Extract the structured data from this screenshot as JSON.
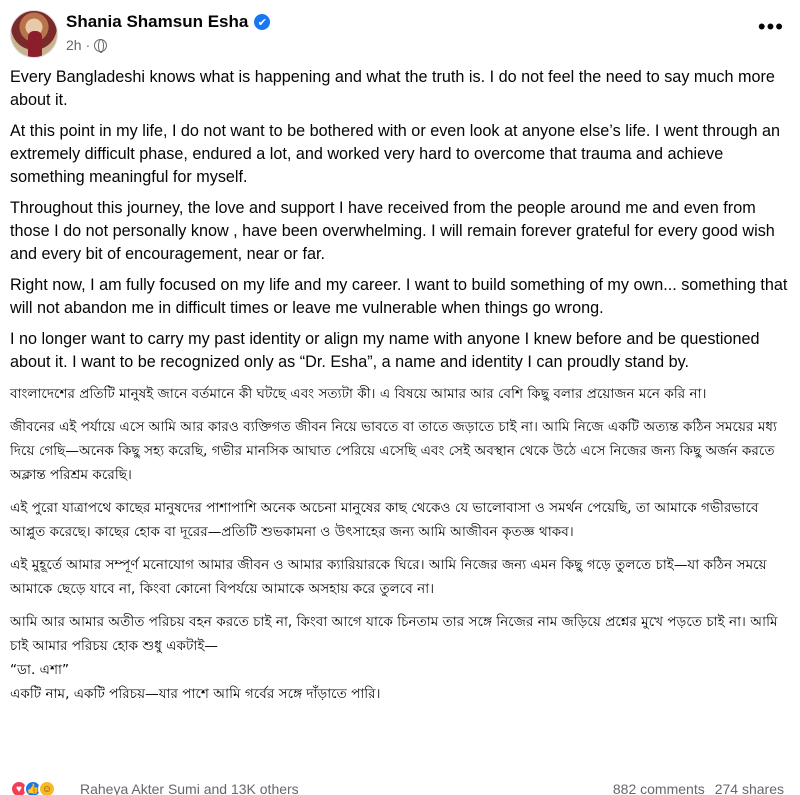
{
  "post": {
    "author": "Shania Shamsun Esha",
    "time": "2h",
    "separator": "·",
    "more_label": "•••",
    "verified_glyph": "✔",
    "paragraphs_en": [
      "Every Bangladeshi knows what is happening and what the truth is. I do not feel the need to say much more about it.",
      "At this point in my life, I do not want to be bothered with or even look at anyone else’s life. I went through an extremely difficult phase, endured a lot, and worked very hard to overcome that trauma and achieve something meaningful for myself.",
      "Throughout this journey, the love and support I have received from the people around me and even from those I do not personally know , have been overwhelming. I will remain forever grateful for every good wish and every bit of encouragement, near or far.",
      "Right now, I am fully focused on my life and my career. I want to build something of my own... something that will not abandon me in difficult times or leave me vulnerable when things go wrong.",
      "I no longer want to carry my past identity or align my name with anyone I knew before  and be questioned about it. I want to be recognized only as “Dr. Esha”, a name and identity I can proudly stand by."
    ],
    "paragraphs_bn": [
      "বাংলাদেশের প্রতিটি মানুষই জানে বর্তমানে কী ঘটছে এবং সত্যটা কী। এ বিষয়ে আমার আর বেশি কিছু বলার প্রয়োজন মনে করি না।",
      "জীবনের এই পর্যায়ে এসে আমি আর কারও ব্যক্তিগত জীবন নিয়ে ভাবতে বা তাতে জড়াতে চাই না। আমি নিজে একটি অত্যন্ত কঠিন সময়ের মধ্য দিয়ে গেছি—অনেক কিছু সহ্য করেছি, গভীর মানসিক আঘাত পেরিয়ে এসেছি এবং সেই অবস্থান থেকে উঠে এসে নিজের জন্য কিছু অর্জন করতে অক্লান্ত পরিশ্রম করেছি।",
      "এই পুরো যাত্রাপথে কাছের মানুষদের পাশাপাশি অনেক অচেনা মানুষের কাছ থেকেও যে ভালোবাসা ও সমর্থন পেয়েছি, তা আমাকে গভীরভাবে আপ্লুত করেছে। কাছের হোক বা দূরের—প্রতিটি শুভকামনা ও উৎসাহের জন্য আমি আজীবন কৃতজ্ঞ থাকব।",
      "এই মুহূর্তে আমার সম্পূর্ণ মনোযোগ আমার জীবন ও আমার ক্যারিয়ারকে ঘিরে। আমি নিজের জন্য এমন কিছু গড়ে তুলতে চাই—যা কঠিন সময়ে আমাকে ছেড়ে যাবে না, কিংবা কোনো বিপর্যয়ে আমাকে অসহায় করে তুলবে না।"
    ],
    "last_bn_lines": [
      "আমি আর আমার অতীত পরিচয় বহন করতে চাই না, কিংবা আগে যাকে চিনতাম তার সঙ্গে নিজের নাম জড়িয়ে প্রশ্নের মুখে পড়তে চাই না। আমি চাই আমার পরিচয় হোক শুধু একটাই—",
      "“ডা. এশা”",
      "একটি নাম, একটি পরিচয়—যার পাশে আমি গর্বের সঙ্গে দাঁড়াতে পারি।"
    ]
  },
  "footer": {
    "reactions_text": "Raheya Akter Sumi and 13K others",
    "comments": "882 comments",
    "shares": "274 shares"
  },
  "icons": [
    "avatar",
    "verified-badge-icon",
    "globe-icon",
    "more-options-icon",
    "love-reaction-icon",
    "like-reaction-icon",
    "care-reaction-icon"
  ],
  "colors": {
    "verified": "#1877f2",
    "meta": "#65676b",
    "love": "#f33e58",
    "care": "#f7b928"
  }
}
